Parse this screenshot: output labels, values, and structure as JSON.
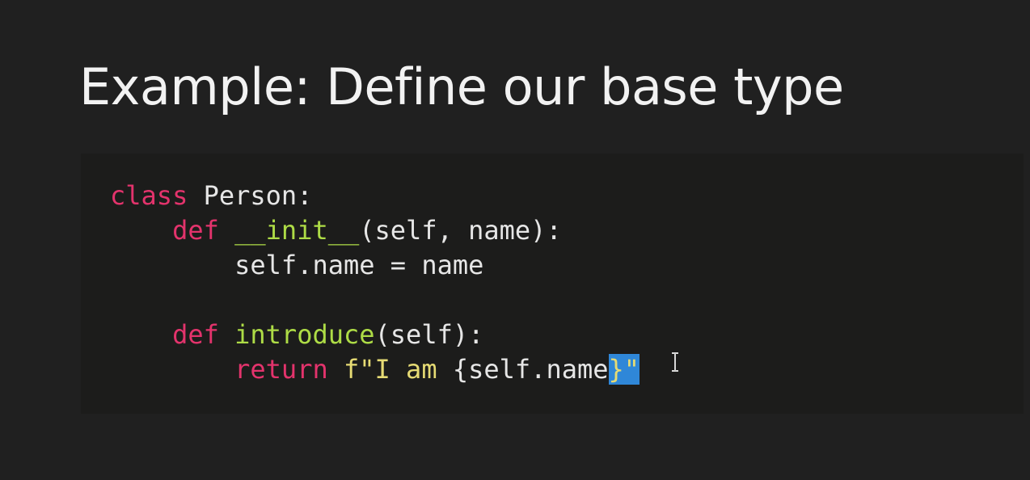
{
  "slide": {
    "title": "Example: Define our base type"
  },
  "code": {
    "language": "python",
    "lines": [
      [
        {
          "t": "class",
          "c": "kw"
        },
        {
          "t": " Person:",
          "c": "plain"
        }
      ],
      [
        {
          "t": "    ",
          "c": "plain"
        },
        {
          "t": "def",
          "c": "kw"
        },
        {
          "t": " ",
          "c": "plain"
        },
        {
          "t": "__init__",
          "c": "fn"
        },
        {
          "t": "(self, name):",
          "c": "plain"
        }
      ],
      [
        {
          "t": "        self.name = name",
          "c": "plain"
        }
      ],
      [],
      [
        {
          "t": "    ",
          "c": "plain"
        },
        {
          "t": "def",
          "c": "kw"
        },
        {
          "t": " ",
          "c": "plain"
        },
        {
          "t": "introduce",
          "c": "fn"
        },
        {
          "t": "(self):",
          "c": "plain"
        }
      ],
      [
        {
          "t": "        ",
          "c": "plain"
        },
        {
          "t": "return",
          "c": "kw"
        },
        {
          "t": " ",
          "c": "plain"
        },
        {
          "t": "f\"I am ",
          "c": "str"
        },
        {
          "t": "{self.name",
          "c": "plain"
        },
        {
          "t": "}\"",
          "c": "sel"
        }
      ]
    ]
  },
  "colors": {
    "background": "#202020",
    "keyword": "#e3336c",
    "function": "#aedc46",
    "string": "#e6db74",
    "selection": "#2f87d8"
  }
}
